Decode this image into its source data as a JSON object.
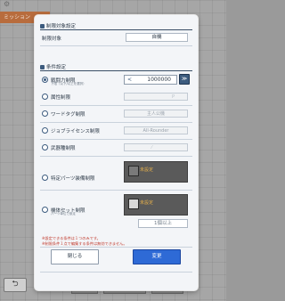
{
  "background": {
    "top_tab_label": "ミッション",
    "back_button_glyph": "⮌",
    "bottom_buttons": [
      "保存",
      "設定をコピー",
      "初期化"
    ]
  },
  "modal": {
    "target_section": {
      "title": "制限対象設定",
      "field_label": "制限対象",
      "field_value": "自機"
    },
    "conditions_section": {
      "title": "条件設定",
      "rows": [
        {
          "label": "戦闘力制限",
          "sub": "下限（以下/以上を選択）",
          "selected": true
        },
        {
          "label": "属性制限",
          "input": ""
        },
        {
          "label": "ワードタグ制限",
          "input": "主人公機"
        },
        {
          "label": "ジョブライセンス制限",
          "input": "All-Rounder"
        },
        {
          "label": "武器種制限",
          "input": ""
        },
        {
          "label": "特定パーツ装備制限",
          "slot_text": "未設定"
        },
        {
          "label": "機体セット制限",
          "sub": "パーツ単位で設定",
          "slot_text": "未設定",
          "extra_input": "1個以上"
        }
      ],
      "power_limit": {
        "comparator": "<",
        "value": "1000000",
        "chevron": "≫"
      }
    },
    "notes": [
      "※設定できる条件は１つのみです。",
      "※制限条件１点で編集する条件は無効できません。"
    ],
    "footer": {
      "close_label": "閉じる",
      "confirm_label": "変更"
    },
    "colors": {
      "accent": "#3c5b7e",
      "confirm": "#2e6ad6",
      "slot": "#5a5a5a",
      "note": "#c0392b"
    }
  }
}
